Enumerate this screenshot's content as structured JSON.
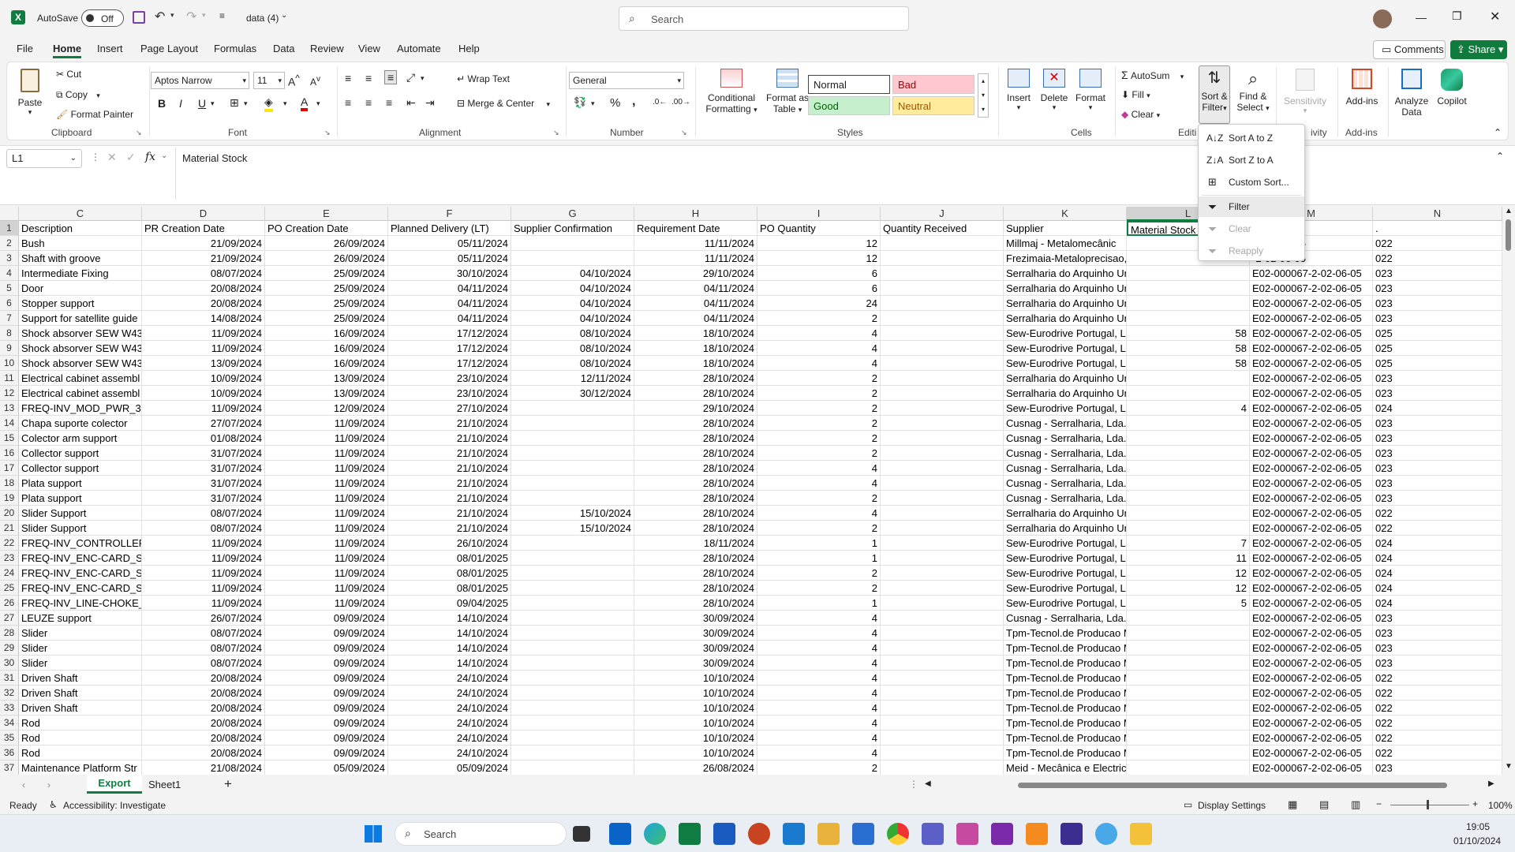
{
  "titlebar": {
    "autosave_label": "AutoSave",
    "autosave_state": "Off",
    "filename": "data (4)",
    "search_placeholder": "Search"
  },
  "ribbon_tabs": [
    "File",
    "Home",
    "Insert",
    "Page Layout",
    "Formulas",
    "Data",
    "Review",
    "View",
    "Automate",
    "Help"
  ],
  "ribbon_right": {
    "comments": "Comments",
    "share": "Share"
  },
  "clipboard": {
    "paste": "Paste",
    "cut": "Cut",
    "copy": "Copy",
    "format_painter": "Format Painter",
    "group": "Clipboard"
  },
  "font": {
    "name": "Aptos Narrow",
    "size": "11",
    "group": "Font"
  },
  "alignment": {
    "wrap": "Wrap Text",
    "merge": "Merge & Center",
    "group": "Alignment"
  },
  "number": {
    "format": "General",
    "group": "Number"
  },
  "styles": {
    "cond1": "Conditional",
    "cond2": "Formatting",
    "fmt1": "Format as",
    "fmt2": "Table",
    "normal": "Normal",
    "bad": "Bad",
    "good": "Good",
    "neutral": "Neutral",
    "group": "Styles"
  },
  "cells": {
    "insert": "Insert",
    "delete": "Delete",
    "format": "Format",
    "group": "Cells"
  },
  "editing": {
    "autosum": "AutoSum",
    "fill": "Fill",
    "clear": "Clear",
    "sort1": "Sort &",
    "sort2": "Filter",
    "find1": "Find &",
    "find2": "Select",
    "group": "Editi"
  },
  "sensitivity": {
    "label": "Sensitivity",
    "group": "ivity"
  },
  "addins": {
    "label": "Add-ins",
    "group": "Add-ins"
  },
  "analyze": {
    "l1": "Analyze",
    "l2": "Data"
  },
  "copilot": {
    "label": "Copilot"
  },
  "formula_bar": {
    "namebox": "L1",
    "fx": "fx",
    "content": "Material Stock"
  },
  "dropdown": {
    "sort_az": "Sort A to Z",
    "sort_za": "Sort Z to A",
    "custom": "Custom Sort...",
    "filter": "Filter",
    "clear": "Clear",
    "reapply": "Reapply"
  },
  "columns": [
    "C",
    "D",
    "E",
    "F",
    "G",
    "H",
    "I",
    "J",
    "K",
    "L",
    "M",
    "N"
  ],
  "headers": [
    "Description",
    "PR Creation Date",
    "PO Creation Date",
    "Planned Delivery (LT)",
    "Supplier Confirmation",
    "Requirement Date",
    "PO Quantity",
    "Quantity Received",
    "Supplier",
    "Material Stock",
    "nt",
    "."
  ],
  "rows": [
    [
      "2",
      "Bush",
      "21/09/2024",
      "26/09/2024",
      "05/11/2024",
      "",
      "11/11/2024",
      "12",
      "",
      "Millmaj - Metalomecânic",
      "",
      "-2-02-06-05",
      "022"
    ],
    [
      "3",
      "Shaft with groove",
      "21/09/2024",
      "26/09/2024",
      "05/11/2024",
      "",
      "11/11/2024",
      "12",
      "",
      "Frezimaia-Metaloprecisao,Lda",
      "",
      "-2-02-06-05",
      "022"
    ],
    [
      "4",
      "Intermediate Fixing",
      "08/07/2024",
      "25/09/2024",
      "30/10/2024",
      "04/10/2024",
      "29/10/2024",
      "6",
      "",
      "Serralharia do Arquinho Unipessoal",
      "",
      "E02-000067-2-02-06-05",
      "023"
    ],
    [
      "5",
      "Door",
      "20/08/2024",
      "25/09/2024",
      "04/11/2024",
      "04/10/2024",
      "04/11/2024",
      "6",
      "",
      "Serralharia do Arquinho Unipessoal",
      "",
      "E02-000067-2-02-06-05",
      "023"
    ],
    [
      "6",
      "Stopper support",
      "20/08/2024",
      "25/09/2024",
      "04/11/2024",
      "04/10/2024",
      "04/11/2024",
      "24",
      "",
      "Serralharia do Arquinho Unipessoal",
      "",
      "E02-000067-2-02-06-05",
      "023"
    ],
    [
      "7",
      "Support for satellite guide",
      "14/08/2024",
      "25/09/2024",
      "04/11/2024",
      "04/10/2024",
      "04/11/2024",
      "2",
      "",
      "Serralharia do Arquinho Unipessoal",
      "",
      "E02-000067-2-02-06-05",
      "023"
    ],
    [
      "8",
      "Shock absorver SEW W43",
      "11/09/2024",
      "16/09/2024",
      "17/12/2024",
      "08/10/2024",
      "18/10/2024",
      "4",
      "",
      "Sew-Eurodrive Portugal, L",
      "58",
      "E02-000067-2-02-06-05",
      "025"
    ],
    [
      "9",
      "Shock absorver SEW W43",
      "11/09/2024",
      "16/09/2024",
      "17/12/2024",
      "08/10/2024",
      "18/10/2024",
      "4",
      "",
      "Sew-Eurodrive Portugal, L",
      "58",
      "E02-000067-2-02-06-05",
      "025"
    ],
    [
      "10",
      "Shock absorver SEW W43",
      "13/09/2024",
      "16/09/2024",
      "17/12/2024",
      "08/10/2024",
      "18/10/2024",
      "4",
      "",
      "Sew-Eurodrive Portugal, L",
      "58",
      "E02-000067-2-02-06-05",
      "025"
    ],
    [
      "11",
      "Electrical cabinet assembl",
      "10/09/2024",
      "13/09/2024",
      "23/10/2024",
      "12/11/2024",
      "28/10/2024",
      "2",
      "",
      "Serralharia do Arquinho Unipessoal",
      "",
      "E02-000067-2-02-06-05",
      "023"
    ],
    [
      "12",
      "Electrical cabinet assembl",
      "10/09/2024",
      "13/09/2024",
      "23/10/2024",
      "30/12/2024",
      "28/10/2024",
      "2",
      "",
      "Serralharia do Arquinho Unipessoal",
      "",
      "E02-000067-2-02-06-05",
      "023"
    ],
    [
      "13",
      "FREQ-INV_MOD_PWR_380",
      "11/09/2024",
      "12/09/2024",
      "27/10/2024",
      "",
      "29/10/2024",
      "2",
      "",
      "Sew-Eurodrive Portugal, L",
      "4",
      "E02-000067-2-02-06-05",
      "024"
    ],
    [
      "14",
      "Chapa suporte colector",
      "27/07/2024",
      "11/09/2024",
      "21/10/2024",
      "",
      "28/10/2024",
      "2",
      "",
      "Cusnag - Serralharia, Lda.",
      "",
      "E02-000067-2-02-06-05",
      "023"
    ],
    [
      "15",
      "Colector arm support",
      "01/08/2024",
      "11/09/2024",
      "21/10/2024",
      "",
      "28/10/2024",
      "2",
      "",
      "Cusnag - Serralharia, Lda.",
      "",
      "E02-000067-2-02-06-05",
      "023"
    ],
    [
      "16",
      "Collector support",
      "31/07/2024",
      "11/09/2024",
      "21/10/2024",
      "",
      "28/10/2024",
      "2",
      "",
      "Cusnag - Serralharia, Lda.",
      "",
      "E02-000067-2-02-06-05",
      "023"
    ],
    [
      "17",
      "Collector support",
      "31/07/2024",
      "11/09/2024",
      "21/10/2024",
      "",
      "28/10/2024",
      "4",
      "",
      "Cusnag - Serralharia, Lda.",
      "",
      "E02-000067-2-02-06-05",
      "023"
    ],
    [
      "18",
      "Plata support",
      "31/07/2024",
      "11/09/2024",
      "21/10/2024",
      "",
      "28/10/2024",
      "4",
      "",
      "Cusnag - Serralharia, Lda.",
      "",
      "E02-000067-2-02-06-05",
      "023"
    ],
    [
      "19",
      "Plata support",
      "31/07/2024",
      "11/09/2024",
      "21/10/2024",
      "",
      "28/10/2024",
      "2",
      "",
      "Cusnag - Serralharia, Lda.",
      "",
      "E02-000067-2-02-06-05",
      "023"
    ],
    [
      "20",
      "Slider Support",
      "08/07/2024",
      "11/09/2024",
      "21/10/2024",
      "15/10/2024",
      "28/10/2024",
      "4",
      "",
      "Serralharia do Arquinho Unipessoal",
      "",
      "E02-000067-2-02-06-05",
      "022"
    ],
    [
      "21",
      "Slider Support",
      "08/07/2024",
      "11/09/2024",
      "21/10/2024",
      "15/10/2024",
      "28/10/2024",
      "2",
      "",
      "Serralharia do Arquinho Unipessoal",
      "",
      "E02-000067-2-02-06-05",
      "022"
    ],
    [
      "22",
      "FREQ-INV_CONTROLLER",
      "11/09/2024",
      "11/09/2024",
      "26/10/2024",
      "",
      "18/11/2024",
      "1",
      "",
      "Sew-Eurodrive Portugal, L",
      "7",
      "E02-000067-2-02-06-05",
      "024"
    ],
    [
      "23",
      "FREQ-INV_ENC-CARD_SAF",
      "11/09/2024",
      "11/09/2024",
      "08/01/2025",
      "",
      "28/10/2024",
      "1",
      "",
      "Sew-Eurodrive Portugal, L",
      "11",
      "E02-000067-2-02-06-05",
      "024"
    ],
    [
      "24",
      "FREQ-INV_ENC-CARD_SAF",
      "11/09/2024",
      "11/09/2024",
      "08/01/2025",
      "",
      "28/10/2024",
      "2",
      "",
      "Sew-Eurodrive Portugal, L",
      "12",
      "E02-000067-2-02-06-05",
      "024"
    ],
    [
      "25",
      "FREQ-INV_ENC-CARD_SAF",
      "11/09/2024",
      "11/09/2024",
      "08/01/2025",
      "",
      "28/10/2024",
      "2",
      "",
      "Sew-Eurodrive Portugal, L",
      "12",
      "E02-000067-2-02-06-05",
      "024"
    ],
    [
      "26",
      "FREQ-INV_LINE-CHOKE_14",
      "11/09/2024",
      "11/09/2024",
      "09/04/2025",
      "",
      "28/10/2024",
      "1",
      "",
      "Sew-Eurodrive Portugal, L",
      "5",
      "E02-000067-2-02-06-05",
      "024"
    ],
    [
      "27",
      "LEUZE support",
      "26/07/2024",
      "09/09/2024",
      "14/10/2024",
      "",
      "30/09/2024",
      "4",
      "",
      "Cusnag - Serralharia, Lda.",
      "",
      "E02-000067-2-02-06-05",
      "023"
    ],
    [
      "28",
      "Slider",
      "08/07/2024",
      "09/09/2024",
      "14/10/2024",
      "",
      "30/09/2024",
      "4",
      "",
      "Tpm-Tecnol.de Producao Mec.Lda",
      "",
      "E02-000067-2-02-06-05",
      "023"
    ],
    [
      "29",
      "Slider",
      "08/07/2024",
      "09/09/2024",
      "14/10/2024",
      "",
      "30/09/2024",
      "4",
      "",
      "Tpm-Tecnol.de Producao Mec.Lda",
      "",
      "E02-000067-2-02-06-05",
      "023"
    ],
    [
      "30",
      "Slider",
      "08/07/2024",
      "09/09/2024",
      "14/10/2024",
      "",
      "30/09/2024",
      "4",
      "",
      "Tpm-Tecnol.de Producao Mec.Lda",
      "",
      "E02-000067-2-02-06-05",
      "023"
    ],
    [
      "31",
      "Driven Shaft",
      "20/08/2024",
      "09/09/2024",
      "24/10/2024",
      "",
      "10/10/2024",
      "4",
      "",
      "Tpm-Tecnol.de Producao Mec.Lda",
      "",
      "E02-000067-2-02-06-05",
      "022"
    ],
    [
      "32",
      "Driven Shaft",
      "20/08/2024",
      "09/09/2024",
      "24/10/2024",
      "",
      "10/10/2024",
      "4",
      "",
      "Tpm-Tecnol.de Producao Mec.Lda",
      "",
      "E02-000067-2-02-06-05",
      "022"
    ],
    [
      "33",
      "Driven Shaft",
      "20/08/2024",
      "09/09/2024",
      "24/10/2024",
      "",
      "10/10/2024",
      "4",
      "",
      "Tpm-Tecnol.de Producao Mec.Lda",
      "",
      "E02-000067-2-02-06-05",
      "022"
    ],
    [
      "34",
      "Rod",
      "20/08/2024",
      "09/09/2024",
      "24/10/2024",
      "",
      "10/10/2024",
      "4",
      "",
      "Tpm-Tecnol.de Producao Mec.Lda",
      "",
      "E02-000067-2-02-06-05",
      "022"
    ],
    [
      "35",
      "Rod",
      "20/08/2024",
      "09/09/2024",
      "24/10/2024",
      "",
      "10/10/2024",
      "4",
      "",
      "Tpm-Tecnol.de Producao Mec.Lda",
      "",
      "E02-000067-2-02-06-05",
      "022"
    ],
    [
      "36",
      "Rod",
      "20/08/2024",
      "09/09/2024",
      "24/10/2024",
      "",
      "10/10/2024",
      "4",
      "",
      "Tpm-Tecnol.de Producao Mec.Lda",
      "",
      "E02-000067-2-02-06-05",
      "022"
    ],
    [
      "37",
      "Maintenance Platform Str",
      "21/08/2024",
      "05/09/2024",
      "05/09/2024",
      "",
      "26/08/2024",
      "2",
      "",
      "Meid - Mecânica e Electricidade",
      "",
      "E02-000067-2-02-06-05",
      "023"
    ]
  ],
  "sheets": {
    "active": "Export",
    "other": "Sheet1",
    "add": "+"
  },
  "status": {
    "ready": "Ready",
    "accessibility": "Accessibility: Investigate",
    "display": "Display Settings",
    "zoom": "100%"
  },
  "taskbar": {
    "search": "Search",
    "time": "19:05",
    "date": "01/10/2024"
  },
  "colors": {
    "excel_green": "#107c41",
    "share_green": "#0f7b3c",
    "bad_bg": "#ffc7ce",
    "bad_fg": "#9c0006",
    "good_bg": "#c6efce",
    "good_fg": "#006100",
    "neutral_bg": "#ffeb9c",
    "neutral_fg": "#9c5700"
  }
}
